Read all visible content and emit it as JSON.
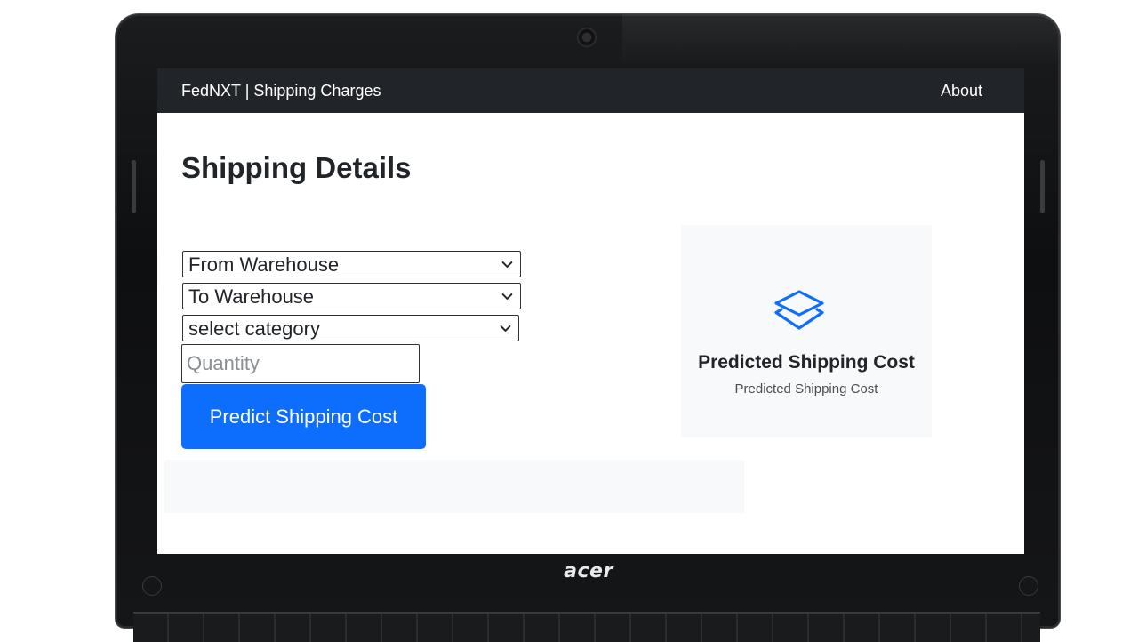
{
  "navbar": {
    "brand": "FedNXT | Shipping Charges",
    "about_link": "About"
  },
  "page": {
    "title": "Shipping Details"
  },
  "form": {
    "from_warehouse": {
      "selected": "From Warehouse"
    },
    "to_warehouse": {
      "selected": "To Warehouse"
    },
    "category": {
      "selected": "select category"
    },
    "quantity": {
      "value": "",
      "placeholder": "Quantity"
    },
    "predict_button_label": "Predict Shipping Cost"
  },
  "result_card": {
    "icon": "layers-icon",
    "title": "Predicted Shipping Cost",
    "subtitle": "Predicted Shipping Cost"
  },
  "device": {
    "brand": "acer"
  },
  "colors": {
    "navbar_bg": "#212529",
    "primary": "#0d6efd",
    "card_bg": "#f8f9fa",
    "text": "#212529"
  }
}
